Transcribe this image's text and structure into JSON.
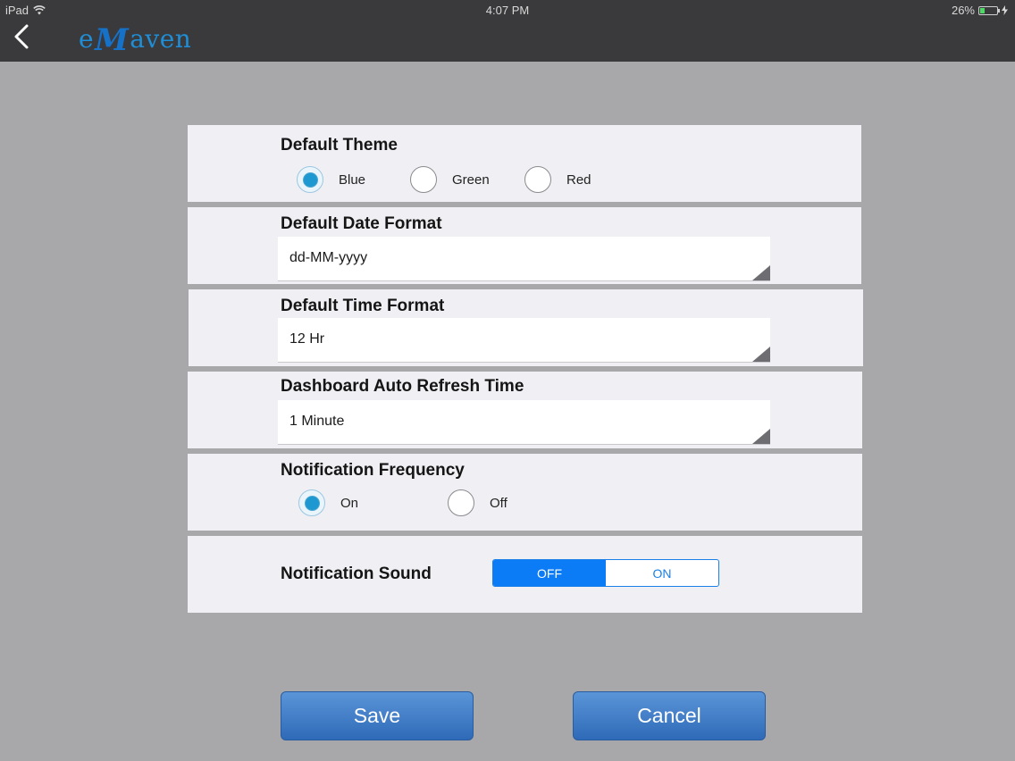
{
  "status_bar": {
    "device": "iPad",
    "time": "4:07 PM",
    "battery": "26%",
    "battery_level": 0.26
  },
  "header": {
    "logo_prefix": "e",
    "logo_mark": "M",
    "logo_suffix": "aven"
  },
  "theme": {
    "title": "Default Theme",
    "options": [
      {
        "label": "Blue",
        "selected": true
      },
      {
        "label": "Green",
        "selected": false
      },
      {
        "label": "Red",
        "selected": false
      }
    ]
  },
  "date_format": {
    "title": "Default Date Format",
    "value": "dd-MM-yyyy"
  },
  "time_format": {
    "title": "Default Time Format",
    "value": "12 Hr"
  },
  "refresh": {
    "title": "Dashboard Auto Refresh Time",
    "value": "1 Minute"
  },
  "notification_frequency": {
    "title": "Notification Frequency",
    "options": [
      {
        "label": "On",
        "selected": true
      },
      {
        "label": "Off",
        "selected": false
      }
    ]
  },
  "notification_sound": {
    "title": "Notification Sound",
    "options": [
      {
        "label": "OFF",
        "selected": true
      },
      {
        "label": "ON",
        "selected": false
      }
    ]
  },
  "actions": {
    "save_label": "Save",
    "cancel_label": "Cancel"
  },
  "colors": {
    "accent": "#0b7cf5",
    "radio_fill": "#1e98d0",
    "button": "#3f7bc6"
  }
}
